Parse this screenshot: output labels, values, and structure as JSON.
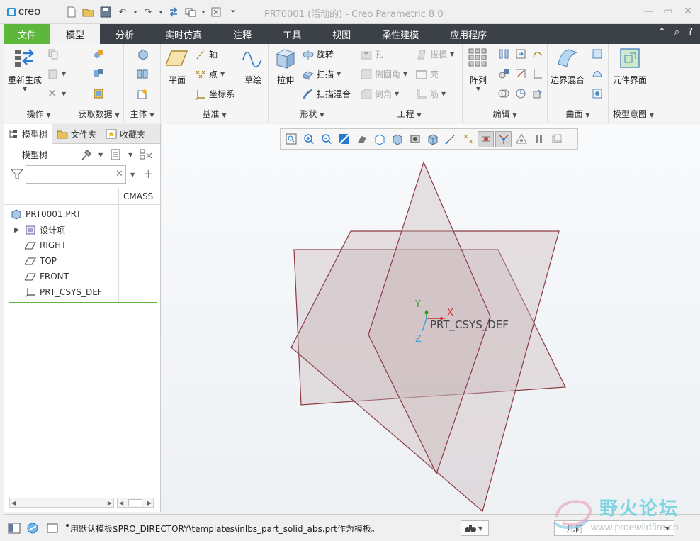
{
  "app": {
    "logo": "creo",
    "window_title": "PRT0001 (活动的) - Creo Parametric 8.0"
  },
  "menu": {
    "file": "文件",
    "tabs": [
      "模型",
      "分析",
      "实时仿真",
      "注释",
      "工具",
      "视图",
      "柔性建模",
      "应用程序"
    ]
  },
  "ribbon": {
    "operations": {
      "label": "操作",
      "regenerate": "重新生成"
    },
    "get_data": {
      "label": "获取数据"
    },
    "body": {
      "label": "主体"
    },
    "datum": {
      "label": "基准",
      "plane": "平面",
      "axis": "轴",
      "point": "点",
      "csys": "坐标系",
      "sketch": "草绘"
    },
    "shapes": {
      "label": "形状",
      "extrude": "拉伸",
      "revolve": "旋转",
      "sweep": "扫描",
      "swept_blend": "扫描混合"
    },
    "engineering": {
      "label": "工程",
      "hole": "孔",
      "round": "倒圆角",
      "chamfer": "倒角",
      "draft": "拔模",
      "shell": "壳",
      "rib": "筋"
    },
    "editing": {
      "label": "编辑",
      "pattern": "阵列"
    },
    "surfaces": {
      "label": "曲面",
      "boundary_blend": "边界混合"
    },
    "model_intent": {
      "label": "模型意图",
      "component_interface": "元件界面"
    }
  },
  "left_panel": {
    "tabs": [
      "模型树",
      "文件夹",
      "收藏夹"
    ],
    "toolbar_label": "模型树",
    "filter_value": "",
    "column": "CMASS",
    "tree": [
      {
        "label": "PRT0001.PRT",
        "icon": "part-icon"
      },
      {
        "label": "设计项",
        "icon": "design-items-icon"
      },
      {
        "label": "RIGHT",
        "icon": "datum-plane-icon"
      },
      {
        "label": "TOP",
        "icon": "datum-plane-icon"
      },
      {
        "label": "FRONT",
        "icon": "datum-plane-icon"
      },
      {
        "label": "PRT_CSYS_DEF",
        "icon": "csys-icon"
      }
    ]
  },
  "graphics": {
    "csys_label": "PRT_CSYS_DEF",
    "axis_x": "X",
    "axis_y": "Y",
    "axis_z": "Z"
  },
  "status": {
    "message": "用默认模板$PRO_DIRECTORY\\templates\\inlbs_part_solid_abs.prt作为模板。",
    "selection_filter": "几何"
  },
  "watermark": {
    "title": "野火论坛",
    "url": "www.proewildfire.cn"
  },
  "colors": {
    "file_tab": "#5cb73a",
    "menubar": "#3b4147",
    "datum_plane_edge": "#8b3a44",
    "datum_plane_fill": "#d9cdd0"
  }
}
